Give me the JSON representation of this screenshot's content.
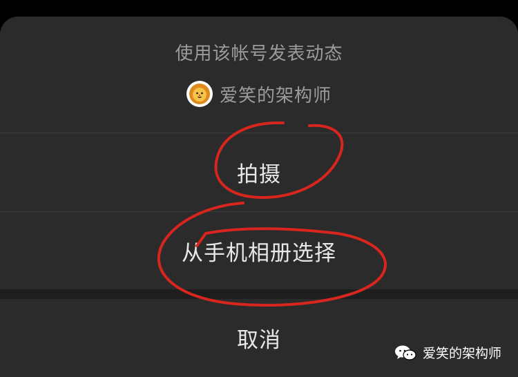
{
  "sheet": {
    "title": "使用该帐号发表动态",
    "account_name": "爱笑的架构师",
    "avatar_icon": "lion-avatar-icon"
  },
  "actions": [
    {
      "label": "拍摄"
    },
    {
      "label": "从手机相册选择"
    }
  ],
  "cancel_label": "取消",
  "watermark": {
    "text": "爱笑的架构师",
    "icon": "wechat-icon"
  },
  "colors": {
    "background": "#000000",
    "sheet": "#2b2b2b",
    "header_text": "#9c9c9c",
    "action_text": "#e8e8e8",
    "annotation": "#d8261f"
  }
}
